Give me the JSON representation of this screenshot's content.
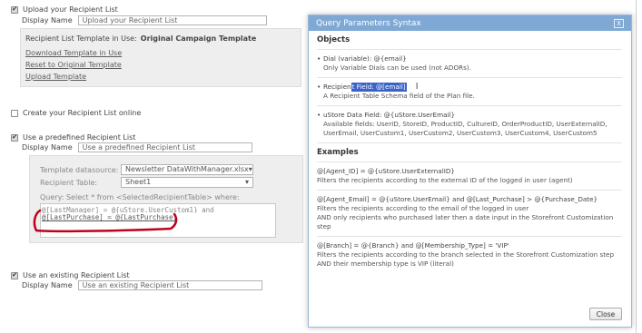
{
  "form": {
    "upload_section": {
      "checkbox_label": "Upload your Recipient List",
      "display_name_label": "Display Name",
      "display_name_value": "Upload your Recipient List",
      "template_in_use_label": "Recipient List Template in Use:",
      "template_in_use_value": "Original Campaign Template",
      "download_link": "Download Template in Use",
      "reset_link": "Reset to Original Template",
      "upload_link": "Upload Template"
    },
    "create_online": {
      "checkbox_label": "Create your Recipient List online"
    },
    "predefined_section": {
      "checkbox_label": "Use a predefined Recipient List",
      "display_name_label": "Display Name",
      "display_name_value": "Use a predefined Recipient List",
      "datasource_label": "Template datasource:",
      "datasource_value": "Newsletter DataWithManager.xlsx",
      "table_label": "Recipient Table:",
      "table_value": "Sheet1",
      "query_label": "Query: Select * from <SelectedRecipientTable> where:",
      "query_line1": "@[LastManager] = @{uStore.UserCustom1} and",
      "query_line2": "@[LastPurchase] = @{LastPurchase}"
    },
    "existing_section": {
      "checkbox_label": "Use an existing Recipient List",
      "display_name_label": "Display Name",
      "display_name_value": "Use an existing Recipient List"
    }
  },
  "modal": {
    "title": "Query Parameters Syntax",
    "close_x": "X",
    "objects_heading": "Objects",
    "dial_title": "Dial (variable): @{email}",
    "dial_desc": "Only Variable Dials can be used (not ADORs).",
    "recipient_prefix": "Recipien",
    "recipient_highlight": "t Field: @[email]",
    "recipient_desc": "A Recipient Table Schema field of the Plan file.",
    "ustore_title": "uStore Data Field: @{uStore.UserEmail}",
    "ustore_desc1": "Available fields: UserID, StoreID, ProductID, CultureID, OrderProductID, UserExternalID,",
    "ustore_desc2": "UserEmail, UserCustom1, UserCustom2, UserCustom3, UserCustom4, UserCustom5",
    "examples_heading": "Examples",
    "ex1_code": "@[Agent_ID] = @{uStore.UserExternalID}",
    "ex1_desc": "Filters the recipients according to the external ID of the logged in user (agent)",
    "ex2_code": "@[Agent_Email] = @{uStore.UserEmail} and @[Last_Purchase] > @{Purchase_Date}",
    "ex2_desc1": "Filters the recipients according to the email of the logged in user",
    "ex2_desc2": "AND only recipients who purchased later then a date input in the Storefront Customization step",
    "ex3_code": "@[Branch] = @{Branch} and @[Membership_Type] = 'VIP'",
    "ex3_desc1": "Filters the recipients according to the branch selected in the Storefront Customization step",
    "ex3_desc2": "AND their membership type is VIP (literal)",
    "close_button": "Close"
  },
  "colors": {
    "modal_header": "#7fa9d4",
    "highlight": "#3a62c9",
    "annotation": "#c0001a"
  }
}
